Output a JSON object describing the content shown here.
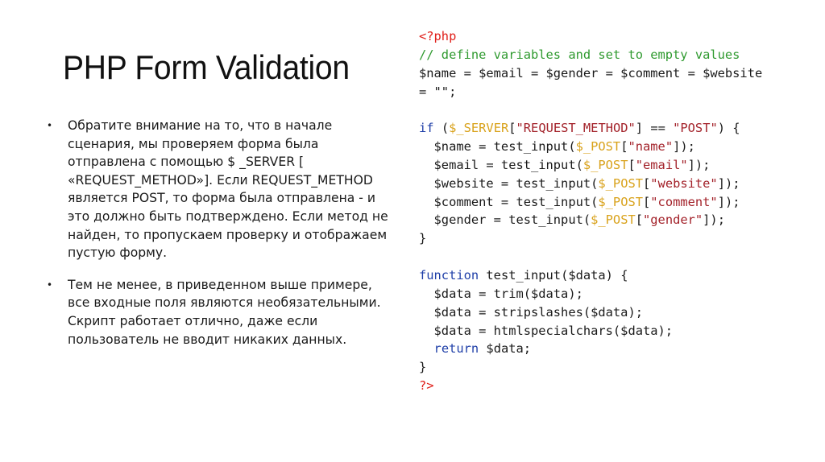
{
  "slide": {
    "title": "PHP Form Validation",
    "bullets": [
      "Обратите внимание на то, что в начале сценария, мы проверяем форма была отправлена с помощью $ _SERVER [ «REQUEST_METHOD»]. Если REQUEST_METHOD является POST, то форма была отправлена - и это должно быть подтверждено. Если метод не найден, то пропускаем проверку и отображаем пустую форму.",
      "Тем не менее, в приведенном выше примере, все входные поля являются необязательными. Скрипт работает отлично, даже если пользователь не вводит никаких данных."
    ],
    "bullet_glyph": "•"
  },
  "colors": {
    "php_tag": "#e0201b",
    "comment": "#2f9a2f",
    "keyword": "#1f3fa8",
    "superglobal": "#d9a21b",
    "string": "#a3222a",
    "text": "#1a1a1a"
  },
  "code": {
    "lines": [
      [
        {
          "t": "tag",
          "v": "<?php"
        }
      ],
      [
        {
          "t": "comment",
          "v": "// define variables and set to empty values"
        }
      ],
      [
        {
          "t": "plain",
          "v": "$name = $email = $gender = $comment = $website"
        }
      ],
      [
        {
          "t": "plain",
          "v": "= \"\";"
        }
      ],
      [],
      [
        {
          "t": "keyword",
          "v": "if"
        },
        {
          "t": "plain",
          "v": " ("
        },
        {
          "t": "super",
          "v": "$_SERVER"
        },
        {
          "t": "plain",
          "v": "["
        },
        {
          "t": "string",
          "v": "\"REQUEST_METHOD\""
        },
        {
          "t": "plain",
          "v": "] == "
        },
        {
          "t": "string",
          "v": "\"POST\""
        },
        {
          "t": "plain",
          "v": ") {"
        }
      ],
      [
        {
          "t": "plain",
          "v": "  $name = test_input("
        },
        {
          "t": "super",
          "v": "$_POST"
        },
        {
          "t": "plain",
          "v": "["
        },
        {
          "t": "string",
          "v": "\"name\""
        },
        {
          "t": "plain",
          "v": "]);"
        }
      ],
      [
        {
          "t": "plain",
          "v": "  $email = test_input("
        },
        {
          "t": "super",
          "v": "$_POST"
        },
        {
          "t": "plain",
          "v": "["
        },
        {
          "t": "string",
          "v": "\"email\""
        },
        {
          "t": "plain",
          "v": "]);"
        }
      ],
      [
        {
          "t": "plain",
          "v": "  $website = test_input("
        },
        {
          "t": "super",
          "v": "$_POST"
        },
        {
          "t": "plain",
          "v": "["
        },
        {
          "t": "string",
          "v": "\"website\""
        },
        {
          "t": "plain",
          "v": "]);"
        }
      ],
      [
        {
          "t": "plain",
          "v": "  $comment = test_input("
        },
        {
          "t": "super",
          "v": "$_POST"
        },
        {
          "t": "plain",
          "v": "["
        },
        {
          "t": "string",
          "v": "\"comment\""
        },
        {
          "t": "plain",
          "v": "]);"
        }
      ],
      [
        {
          "t": "plain",
          "v": "  $gender = test_input("
        },
        {
          "t": "super",
          "v": "$_POST"
        },
        {
          "t": "plain",
          "v": "["
        },
        {
          "t": "string",
          "v": "\"gender\""
        },
        {
          "t": "plain",
          "v": "]);"
        }
      ],
      [
        {
          "t": "plain",
          "v": "}"
        }
      ],
      [],
      [
        {
          "t": "keyword",
          "v": "function"
        },
        {
          "t": "plain",
          "v": " test_input($data) {"
        }
      ],
      [
        {
          "t": "plain",
          "v": "  $data = trim($data);"
        }
      ],
      [
        {
          "t": "plain",
          "v": "  $data = stripslashes($data);"
        }
      ],
      [
        {
          "t": "plain",
          "v": "  $data = htmlspecialchars($data);"
        }
      ],
      [
        {
          "t": "plain",
          "v": "  "
        },
        {
          "t": "keyword",
          "v": "return"
        },
        {
          "t": "plain",
          "v": " $data;"
        }
      ],
      [
        {
          "t": "plain",
          "v": "}"
        }
      ],
      [
        {
          "t": "tag",
          "v": "?>"
        }
      ]
    ]
  }
}
